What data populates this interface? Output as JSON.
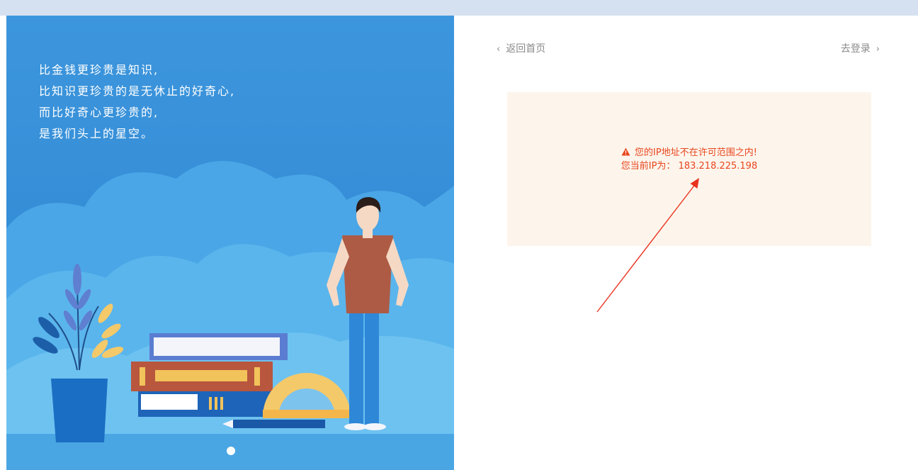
{
  "quote": {
    "line1": "比金钱更珍贵是知识,",
    "line2": "比知识更珍贵的是无休止的好奇心,",
    "line3": "而比好奇心更珍贵的,",
    "line4": "是我们头上的星空。"
  },
  "nav": {
    "back_label": "返回首页",
    "login_label": "去登录"
  },
  "alert": {
    "message": "您的IP地址不在许可范围之内!",
    "ip_label": "您当前IP为：",
    "ip_value": "183.218.225.198"
  },
  "colors": {
    "panel_blue": "#3f9ae0",
    "alert_text": "#e8461e",
    "alert_bg": "#fdf5ec",
    "annotation_arrow": "#e8331e"
  },
  "icons": {
    "back": "chevron-left-icon",
    "login": "chevron-right-icon",
    "warning": "warning-triangle-icon"
  },
  "carousel": {
    "slide_count": 1,
    "active_index": 0
  }
}
